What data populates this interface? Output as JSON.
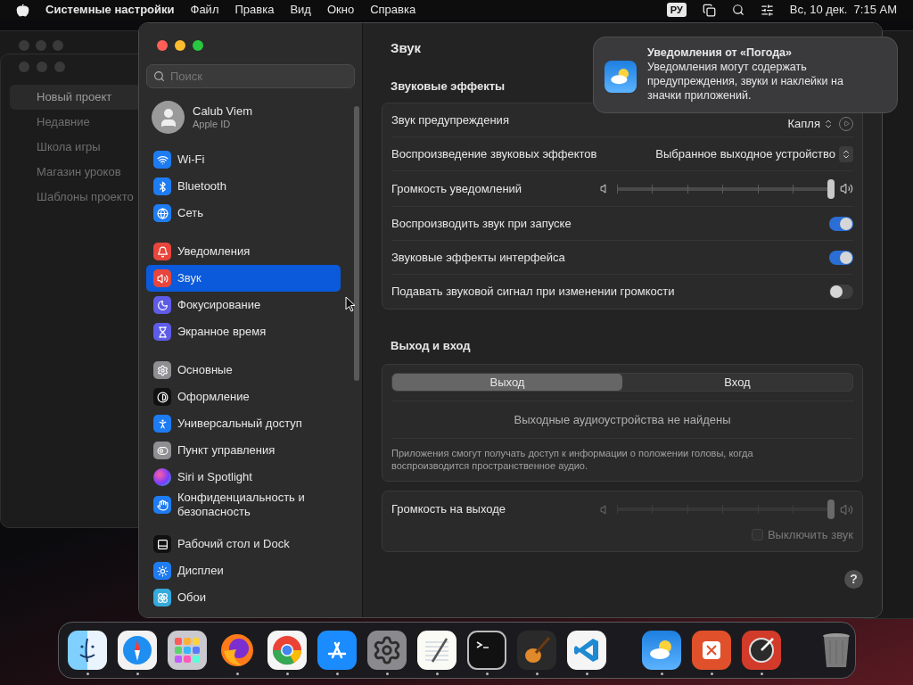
{
  "menu_bar": {
    "app": "Системные настройки",
    "menus": [
      "Файл",
      "Правка",
      "Вид",
      "Окно",
      "Справка"
    ],
    "input_source": "РУ",
    "clock": "Вс, 10 дек.  7:15 AM"
  },
  "background_window": {
    "items": [
      {
        "label": "Новый проект",
        "selected": true
      },
      {
        "label": "Недавние",
        "selected": false
      },
      {
        "label": "Школа игры",
        "selected": false
      },
      {
        "label": "Магазин уроков",
        "selected": false
      },
      {
        "label": "Шаблоны проекто",
        "selected": false
      }
    ]
  },
  "sidebar": {
    "search": {
      "placeholder": "Поиск"
    },
    "account": {
      "name": "Calub Viem",
      "subtitle": "Apple ID"
    },
    "groups": [
      [
        {
          "label": "Wi-Fi",
          "kind": "wifi",
          "selected": false
        },
        {
          "label": "Bluetooth",
          "kind": "bluetooth",
          "selected": false
        },
        {
          "label": "Сеть",
          "kind": "network",
          "selected": false
        }
      ],
      [
        {
          "label": "Уведомления",
          "kind": "notifications",
          "selected": false
        },
        {
          "label": "Звук",
          "kind": "sound",
          "selected": true
        },
        {
          "label": "Фокусирование",
          "kind": "focus",
          "selected": false
        },
        {
          "label": "Экранное время",
          "kind": "screentime",
          "selected": false
        }
      ],
      [
        {
          "label": "Основные",
          "kind": "general",
          "selected": false
        },
        {
          "label": "Оформление",
          "kind": "appearance",
          "selected": false
        },
        {
          "label": "Универсальный доступ",
          "kind": "accessibility",
          "selected": false
        },
        {
          "label": "Пункт управления",
          "kind": "control",
          "selected": false
        },
        {
          "label": "Siri и Spotlight",
          "kind": "siri",
          "selected": false
        },
        {
          "label": "Конфиденциальность и безопасность",
          "kind": "privacy",
          "selected": false
        }
      ],
      [
        {
          "label": "Рабочий стол и Dock",
          "kind": "desktop",
          "selected": false
        },
        {
          "label": "Дисплеи",
          "kind": "displays",
          "selected": false
        },
        {
          "label": "Обои",
          "kind": "wallpaper",
          "selected": false
        }
      ]
    ]
  },
  "content": {
    "title": "Звук",
    "sound_effects": {
      "title": "Звуковые эффекты",
      "rows": [
        {
          "kind": "sound",
          "label": "Звук предупреждения",
          "value": "Капля"
        },
        {
          "kind": "popup",
          "label": "Воспроизведение звуковых эффектов",
          "value": "Выбранное выходное устройство"
        },
        {
          "kind": "slider",
          "label": "Громкость уведомлений",
          "level": 1
        },
        {
          "kind": "toggle",
          "label": "Воспроизводить звук при запуске",
          "on": true
        },
        {
          "kind": "toggle",
          "label": "Звуковые эффекты интерфейса",
          "on": true
        },
        {
          "kind": "toggle",
          "label": "Подавать звуковой сигнал при изменении громкости",
          "on": false
        }
      ]
    },
    "output_input": {
      "title": "Выход и вход",
      "tabs": [
        {
          "label": "Выход",
          "selected": true
        },
        {
          "label": "Вход",
          "selected": false
        }
      ],
      "empty_message": "Выходные аудиоустройства не найдены",
      "note": "Приложения смогут получать доступ к информации о положении головы, когда воспроизводится пространственное аудио."
    },
    "output_volume": {
      "label": "Громкость на выходе",
      "level": 1,
      "disabled": true,
      "mute": {
        "label": "Выключить звук",
        "checked": false
      }
    },
    "help": "?"
  },
  "notification": {
    "title": "Уведомления от «Погода»",
    "body": "Уведомления могут содержать предупреждения, звуки и наклейки на значки приложений."
  },
  "dock": {
    "items": [
      {
        "kind": "finder",
        "running": true
      },
      {
        "kind": "safari",
        "running": true
      },
      {
        "kind": "launchpad",
        "running": false
      },
      {
        "kind": "firefox",
        "running": true
      },
      {
        "kind": "chrome",
        "running": true
      },
      {
        "kind": "appstore",
        "running": true
      },
      {
        "kind": "settings",
        "running": true
      },
      {
        "kind": "textedit",
        "running": true
      },
      {
        "kind": "terminal",
        "running": true
      },
      {
        "kind": "garageband",
        "running": true
      },
      {
        "kind": "vscode",
        "running": true
      },
      {
        "kind": "weather",
        "running": true
      },
      {
        "kind": "remote",
        "running": true
      },
      {
        "kind": "instruments",
        "running": true
      },
      {
        "kind": "trash",
        "running": false
      }
    ]
  }
}
